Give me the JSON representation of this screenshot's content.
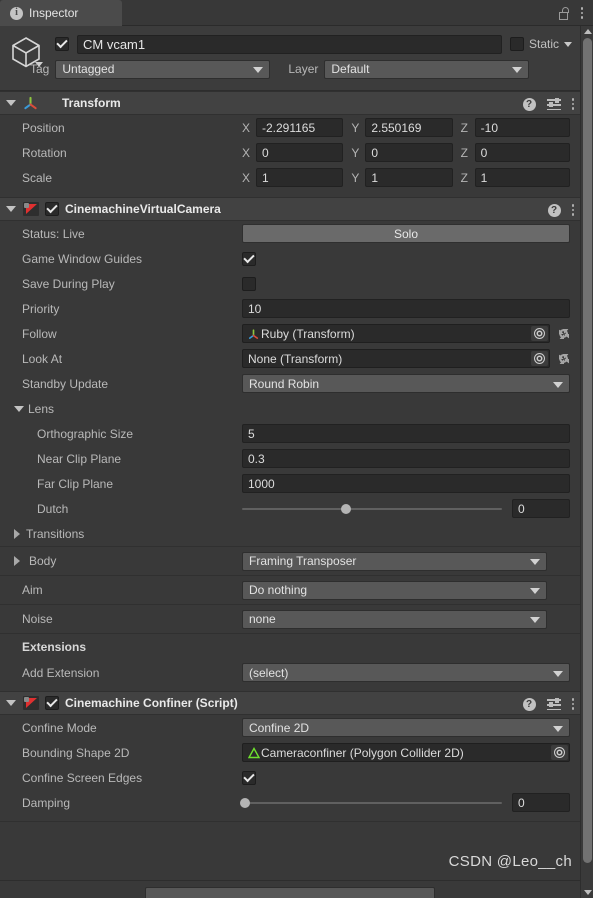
{
  "window": {
    "tab_label": "Inspector",
    "tab_icon": "info-icon",
    "lock_icon": "lock-open-icon",
    "menu_icon": "kebab-menu-icon"
  },
  "object_header": {
    "icon": "gameobject-cube-icon",
    "enabled": true,
    "name": "CM vcam1",
    "static_label": "Static",
    "static_checked": false,
    "tag_label": "Tag",
    "tag_value": "Untagged",
    "layer_label": "Layer",
    "layer_value": "Default"
  },
  "components": [
    {
      "id": "transform",
      "title": "Transform",
      "icon": "transform-axis-icon",
      "expanded": true,
      "has_checkbox": false,
      "header_icons": [
        "help-icon",
        "preset-icon",
        "kebab-menu-icon"
      ],
      "vectors": [
        {
          "label": "Position",
          "x": "-2.291165",
          "y": "2.550169",
          "z": "-10"
        },
        {
          "label": "Rotation",
          "x": "0",
          "y": "0",
          "z": "0"
        },
        {
          "label": "Scale",
          "x": "1",
          "y": "1",
          "z": "1"
        }
      ],
      "axis_labels": {
        "x": "X",
        "y": "Y",
        "z": "Z"
      }
    },
    {
      "id": "cinemachine_virtual_camera",
      "title": "CinemachineVirtualCamera",
      "icon": "cinemachine-icon",
      "expanded": true,
      "has_checkbox": true,
      "checked": true,
      "header_icons": [
        "help-icon",
        "kebab-menu-icon"
      ],
      "status_label": "Status: Live",
      "solo_button": "Solo",
      "rows": [
        {
          "label": "Game Window Guides",
          "type": "checkbox",
          "checked": true
        },
        {
          "label": "Save During Play",
          "type": "checkbox",
          "checked": false
        },
        {
          "label": "Priority",
          "type": "text",
          "value": "10"
        },
        {
          "label": "Follow",
          "type": "object",
          "value": "Ruby (Transform)",
          "icon": "transform-axis-icon",
          "gear": true
        },
        {
          "label": "Look At",
          "type": "object",
          "value": "None (Transform)",
          "icon": "none",
          "gear": true
        },
        {
          "label": "Standby Update",
          "type": "popup",
          "value": "Round Robin"
        }
      ],
      "lens": {
        "label": "Lens",
        "expanded": true,
        "rows": [
          {
            "label": "Orthographic Size",
            "type": "text",
            "value": "5"
          },
          {
            "label": "Near Clip Plane",
            "type": "text",
            "value": "0.3"
          },
          {
            "label": "Far Clip Plane",
            "type": "text",
            "value": "1000"
          },
          {
            "label": "Dutch",
            "type": "slider",
            "value": "0",
            "knob_percent": 40
          }
        ]
      },
      "transitions": {
        "label": "Transitions",
        "expanded": false
      },
      "stages": [
        {
          "label": "Body",
          "value": "Framing Transposer",
          "foldout": true
        },
        {
          "label": "Aim",
          "value": "Do nothing",
          "foldout": false
        },
        {
          "label": "Noise",
          "value": "none",
          "foldout": false
        }
      ],
      "extensions": {
        "title": "Extensions",
        "add_label": "Add Extension",
        "add_value": "(select)"
      }
    },
    {
      "id": "cinemachine_confiner",
      "title": "Cinemachine Confiner (Script)",
      "icon": "cinemachine-icon",
      "expanded": true,
      "has_checkbox": true,
      "checked": true,
      "header_icons": [
        "help-icon",
        "preset-icon",
        "kebab-menu-icon"
      ],
      "rows": [
        {
          "label": "Confine Mode",
          "type": "popup",
          "value": "Confine 2D"
        },
        {
          "label": "Bounding Shape 2D",
          "type": "object",
          "value": "Cameraconfiner (Polygon Collider 2D)",
          "icon": "polygon-collider-icon",
          "gear": false
        },
        {
          "label": "Confine Screen Edges",
          "type": "checkbox",
          "checked": true
        },
        {
          "label": "Damping",
          "type": "slider",
          "value": "0",
          "knob_percent": 0
        }
      ]
    }
  ],
  "watermark": "CSDN @Leo__ch",
  "colors": {
    "panel_bg": "#393939",
    "header_bg": "#424242",
    "field_bg": "#2a2a2a",
    "popup_bg": "#585858",
    "accent_red": "#e03030",
    "accent_green": "#6ee02e"
  }
}
